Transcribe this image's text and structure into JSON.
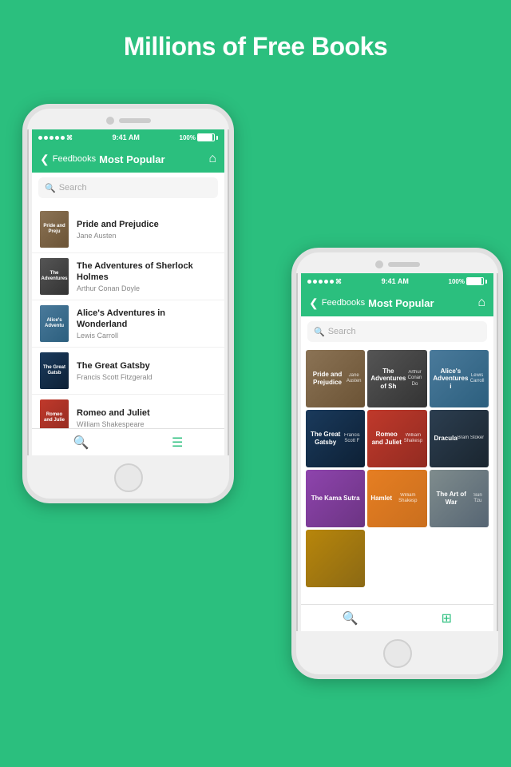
{
  "headline": "Millions of Free Books",
  "app": {
    "name": "Feedbooks",
    "section": "Most Popular",
    "time": "9:41 AM",
    "battery": "100%"
  },
  "search": {
    "placeholder": "Search"
  },
  "books_list": [
    {
      "title": "Pride and Prejudice",
      "author": "Jane Austen",
      "cover_class": "cover-1"
    },
    {
      "title": "The Adventures of Sherlock Holmes",
      "author": "Arthur Conan Doyle",
      "cover_class": "cover-2"
    },
    {
      "title": "Alice's Adventures in Wonderland",
      "author": "Lewis Carroll",
      "cover_class": "cover-3"
    },
    {
      "title": "The Great Gatsby",
      "author": "Francis Scott Fitzgerald",
      "cover_class": "cover-4"
    },
    {
      "title": "Romeo and Juliet",
      "author": "William Shakespeare",
      "cover_class": "cover-5"
    }
  ],
  "books_grid": [
    {
      "title": "Pride and Prejudice",
      "author": "Jane Austen",
      "cover_class": "cover-1"
    },
    {
      "title": "The Adventures of Sherlock Holmes",
      "author": "Arthur Conan Doyle",
      "cover_class": "cover-2"
    },
    {
      "title": "Alice's Adventures in Wonderland",
      "author": "Lewis Carroll",
      "cover_class": "cover-3"
    },
    {
      "title": "The Great Gatsby",
      "author": "Francis Scott Fitzgerald",
      "cover_class": "cover-4"
    },
    {
      "title": "Romeo and Juliet",
      "author": "William Shakespeare",
      "cover_class": "cover-5"
    },
    {
      "title": "Dracula",
      "author": "Bram Stoker",
      "cover_class": "cover-6"
    },
    {
      "title": "The Kama Sutra",
      "author": "",
      "cover_class": "cover-7"
    },
    {
      "title": "Hamlet",
      "author": "William Shakespeare",
      "cover_class": "cover-8"
    },
    {
      "title": "The Art of War",
      "author": "Sun Tzu",
      "cover_class": "cover-9"
    },
    {
      "title": "",
      "author": "",
      "cover_class": "cover-row4"
    }
  ],
  "tabs_left": {
    "search_label": "🔍",
    "menu_label": "☰"
  }
}
